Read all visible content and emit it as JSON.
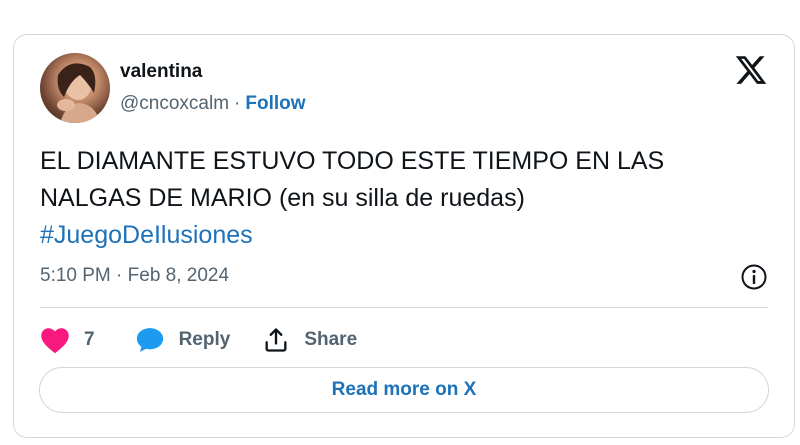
{
  "author": {
    "name": "valentina",
    "handle": "@cncoxcalm",
    "separator": "·",
    "follow_label": "Follow"
  },
  "tweet": {
    "text_line1": "EL DIAMANTE ESTUVO TODO ESTE TIEMPO EN LAS",
    "text_line2": "NALGAS DE MARIO (en su silla de ruedas)",
    "hashtag": "#JuegoDeIlusiones",
    "timestamp": "5:10 PM · Feb 8, 2024"
  },
  "actions": {
    "like_count": "7",
    "reply_label": "Reply",
    "share_label": "Share"
  },
  "read_more_label": "Read more on X",
  "icons": {
    "brand": "x-logo-icon",
    "info": "info-icon",
    "like": "heart-icon",
    "reply": "reply-bubble-icon",
    "share": "share-icon"
  },
  "colors": {
    "link": "#1d72b8",
    "heart": "#f91880",
    "reply_bubble": "#1d9bf0",
    "text": "#0f1419",
    "muted": "#536471",
    "border": "#cfd9de"
  }
}
